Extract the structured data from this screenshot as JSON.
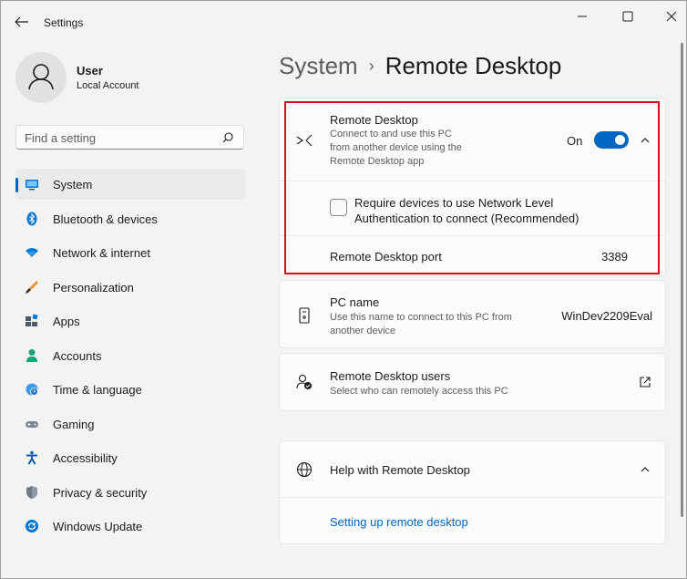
{
  "window": {
    "app_title": "Settings"
  },
  "profile": {
    "name": "User",
    "subtitle": "Local Account"
  },
  "search": {
    "placeholder": "Find a setting"
  },
  "sidebar": {
    "items": [
      {
        "label": "System",
        "icon": "system-icon",
        "active": true
      },
      {
        "label": "Bluetooth & devices",
        "icon": "bluetooth-icon"
      },
      {
        "label": "Network & internet",
        "icon": "wifi-icon"
      },
      {
        "label": "Personalization",
        "icon": "brush-icon"
      },
      {
        "label": "Apps",
        "icon": "apps-icon"
      },
      {
        "label": "Accounts",
        "icon": "person-icon"
      },
      {
        "label": "Time & language",
        "icon": "globe-clock-icon"
      },
      {
        "label": "Gaming",
        "icon": "gamepad-icon"
      },
      {
        "label": "Accessibility",
        "icon": "accessibility-icon"
      },
      {
        "label": "Privacy & security",
        "icon": "shield-icon"
      },
      {
        "label": "Windows Update",
        "icon": "update-icon"
      }
    ]
  },
  "breadcrumb": {
    "parent": "System",
    "separator": "›",
    "current": "Remote Desktop"
  },
  "remote_desktop": {
    "title": "Remote Desktop",
    "desc_line1": "Connect to and use this PC",
    "desc_line2": "from another device using the",
    "desc_line3": "Remote Desktop app",
    "state_label": "On",
    "nla_line1": "Require devices to use Network Level",
    "nla_line2": "Authentication to connect (Recommended)",
    "port_label": "Remote Desktop port",
    "port_value": "3389"
  },
  "pc_name": {
    "title": "PC name",
    "desc_line1": "Use this name to connect to this PC from",
    "desc_line2": "another device",
    "value": "WinDev2209Eval"
  },
  "rd_users": {
    "title": "Remote Desktop users",
    "desc": "Select who can remotely access this PC"
  },
  "help": {
    "title": "Help with Remote Desktop",
    "link": "Setting up remote desktop"
  },
  "colors": {
    "accent": "#0067c0",
    "highlight": "#d0111b"
  }
}
